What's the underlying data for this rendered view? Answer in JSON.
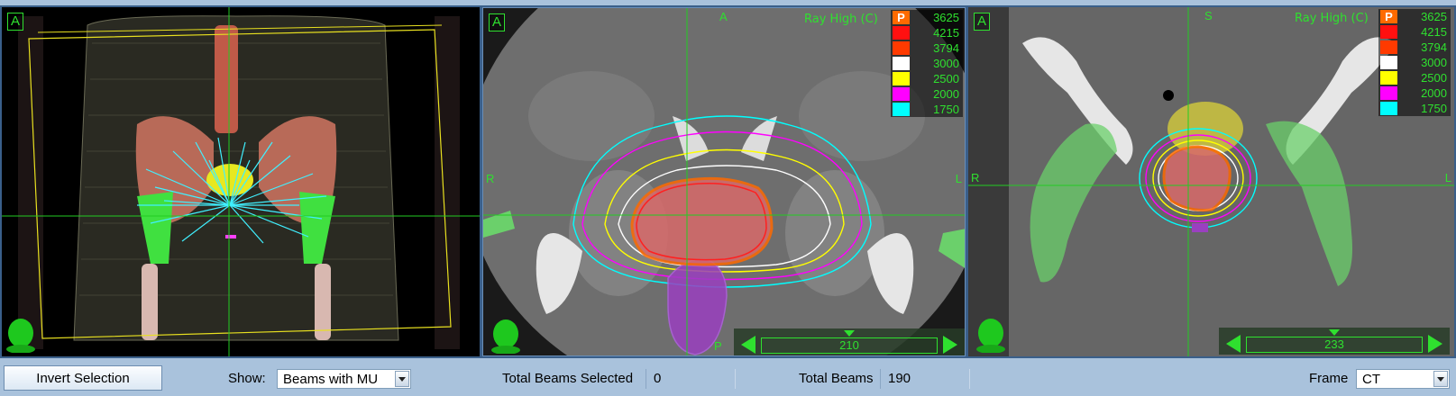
{
  "viewports": {
    "three_d": {
      "flag": "A"
    },
    "axial": {
      "flag": "A",
      "dose_title": "Ray High (C)",
      "orient": {
        "top": "A",
        "left": "R",
        "right": "L",
        "bottom": "P"
      },
      "slice": "210"
    },
    "coronal": {
      "flag": "A",
      "dose_title": "Ray High (C)",
      "orient": {
        "top": "S",
        "left": "R",
        "right": "L"
      },
      "slice": "233"
    },
    "legend": [
      {
        "label": "P",
        "value": "3625",
        "color": "#ff6a00"
      },
      {
        "label": "",
        "value": "4215",
        "color": "#ff1010"
      },
      {
        "label": "",
        "value": "3794",
        "color": "#ff3a00"
      },
      {
        "label": "",
        "value": "3000",
        "color": "#ffffff"
      },
      {
        "label": "",
        "value": "2500",
        "color": "#ffff00"
      },
      {
        "label": "",
        "value": "2000",
        "color": "#ff00ff"
      },
      {
        "label": "",
        "value": "1750",
        "color": "#00ffff"
      }
    ]
  },
  "toolbar": {
    "invert_label": "Invert Selection",
    "show_label": "Show:",
    "show_value": "Beams with MU",
    "total_selected_label": "Total Beams Selected",
    "total_selected_value": "0",
    "total_beams_label": "Total Beams",
    "total_beams_value": "190",
    "frame_label": "Frame",
    "frame_value": "CT"
  },
  "colors": {
    "crosshair": "#22cc22",
    "ptv": "#e07070",
    "bladder": "#d8d040",
    "rectum": "#9a40c0",
    "femur": "#40e040",
    "beams": "#40f0ff"
  }
}
